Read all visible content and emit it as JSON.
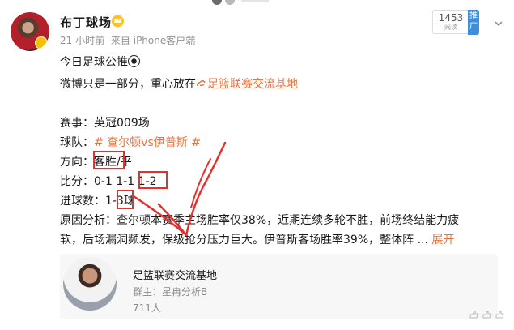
{
  "post": {
    "username": "布丁球场",
    "time": "21 小时前",
    "source": "来自 iPhone客户端",
    "views": "1453",
    "views_label": "阅读",
    "promote_label": "推广",
    "headline": "今日足球公推",
    "intro_prefix": "微博只是一部分，重心放在",
    "intro_link": "足篮联赛交流基地",
    "match_label": "赛事：",
    "match_value": "英冠009场",
    "teams_label": "球队：",
    "teams_value": "# 查尔顿vs伊普斯 #",
    "direction_label": "方向：",
    "direction_value": "客胜/平",
    "score_label": "比分：",
    "score_value": "0-1 1-1 1-2",
    "goals_label": "进球数：",
    "goals_value": "1-3球",
    "analysis_line1": "原因分析：查尔顿本赛季主场胜率仅38%，近期连续多轮不胜，前场终结能力疲",
    "analysis_line2": "软，后场漏洞频发，保级抢分压力巨大。伊普斯客场胜率39%，整体阵 ...",
    "expand_label": "展开"
  },
  "group_card": {
    "title": "足篮联赛交流基地",
    "owner": "群主：星冉分析B",
    "members": "711人"
  },
  "colors": {
    "accent": "#eb7340",
    "annotation": "#e0332f",
    "promo": "#3e8ee0"
  },
  "icons": [
    "vip-crown-icon",
    "more-chevron-icon",
    "football-icon",
    "link-icon",
    "like-icon"
  ]
}
